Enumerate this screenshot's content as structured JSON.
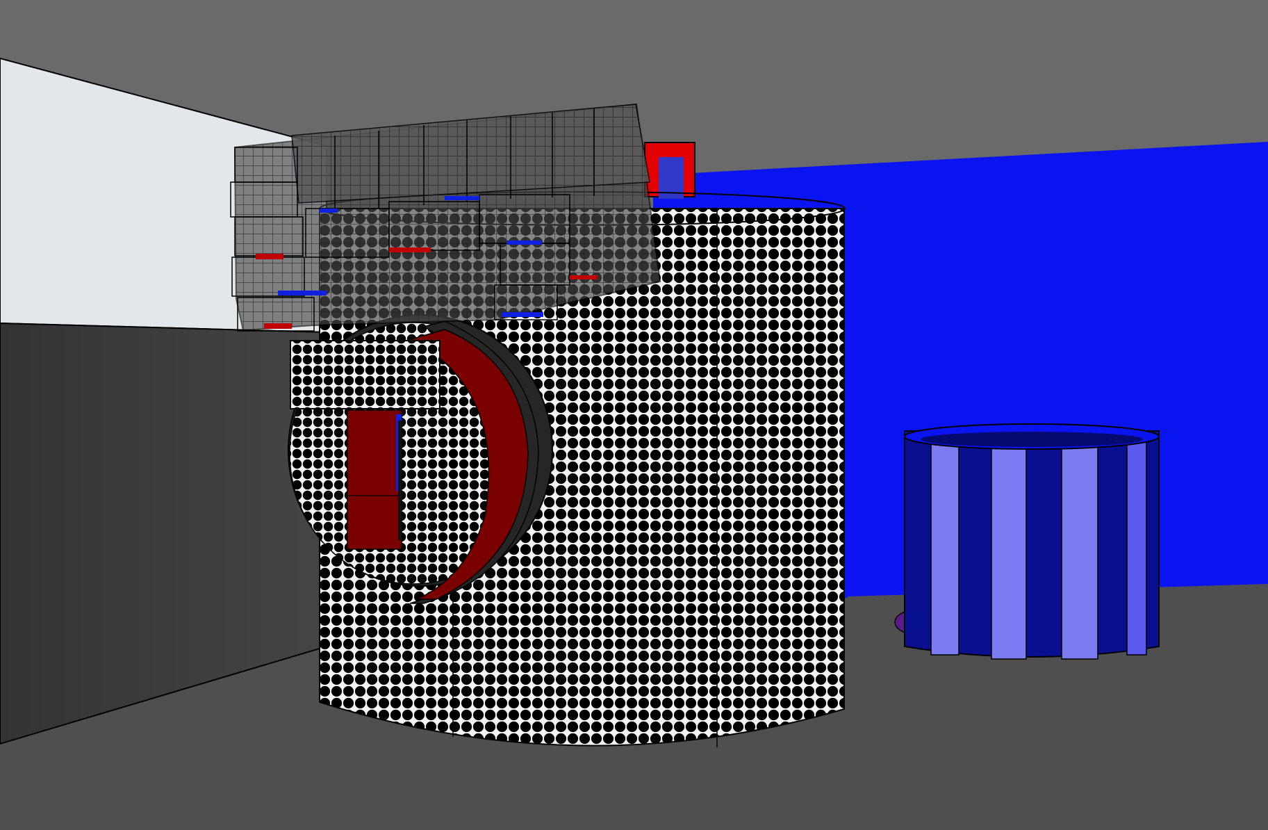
{
  "scene": {
    "colors": {
      "background_top": "#6a6a6a",
      "floor": "#4d4d4d",
      "left_wall_upper": "#e4e7ea",
      "left_wall_lower": "#3b3b3b",
      "blue_wall": "#0a14f0",
      "tower_dots_bg": "#f4f4f4",
      "tower_dots": "#000000",
      "accent_red": "#7a0000",
      "bright_red": "#e20000",
      "stripe_light": "#7c7cf2",
      "stripe_dark": "#08108f",
      "ring_purple": "#5a1a8a",
      "wire_dark": "#3a3a3a",
      "wire_tint": "#7f7f7f"
    },
    "objects": [
      {
        "name": "dotted-cylinder-tower"
      },
      {
        "name": "d-shaped-opening"
      },
      {
        "name": "wireframe-lattice-roof"
      },
      {
        "name": "red-frame"
      },
      {
        "name": "striped-blue-cylinder"
      }
    ]
  }
}
